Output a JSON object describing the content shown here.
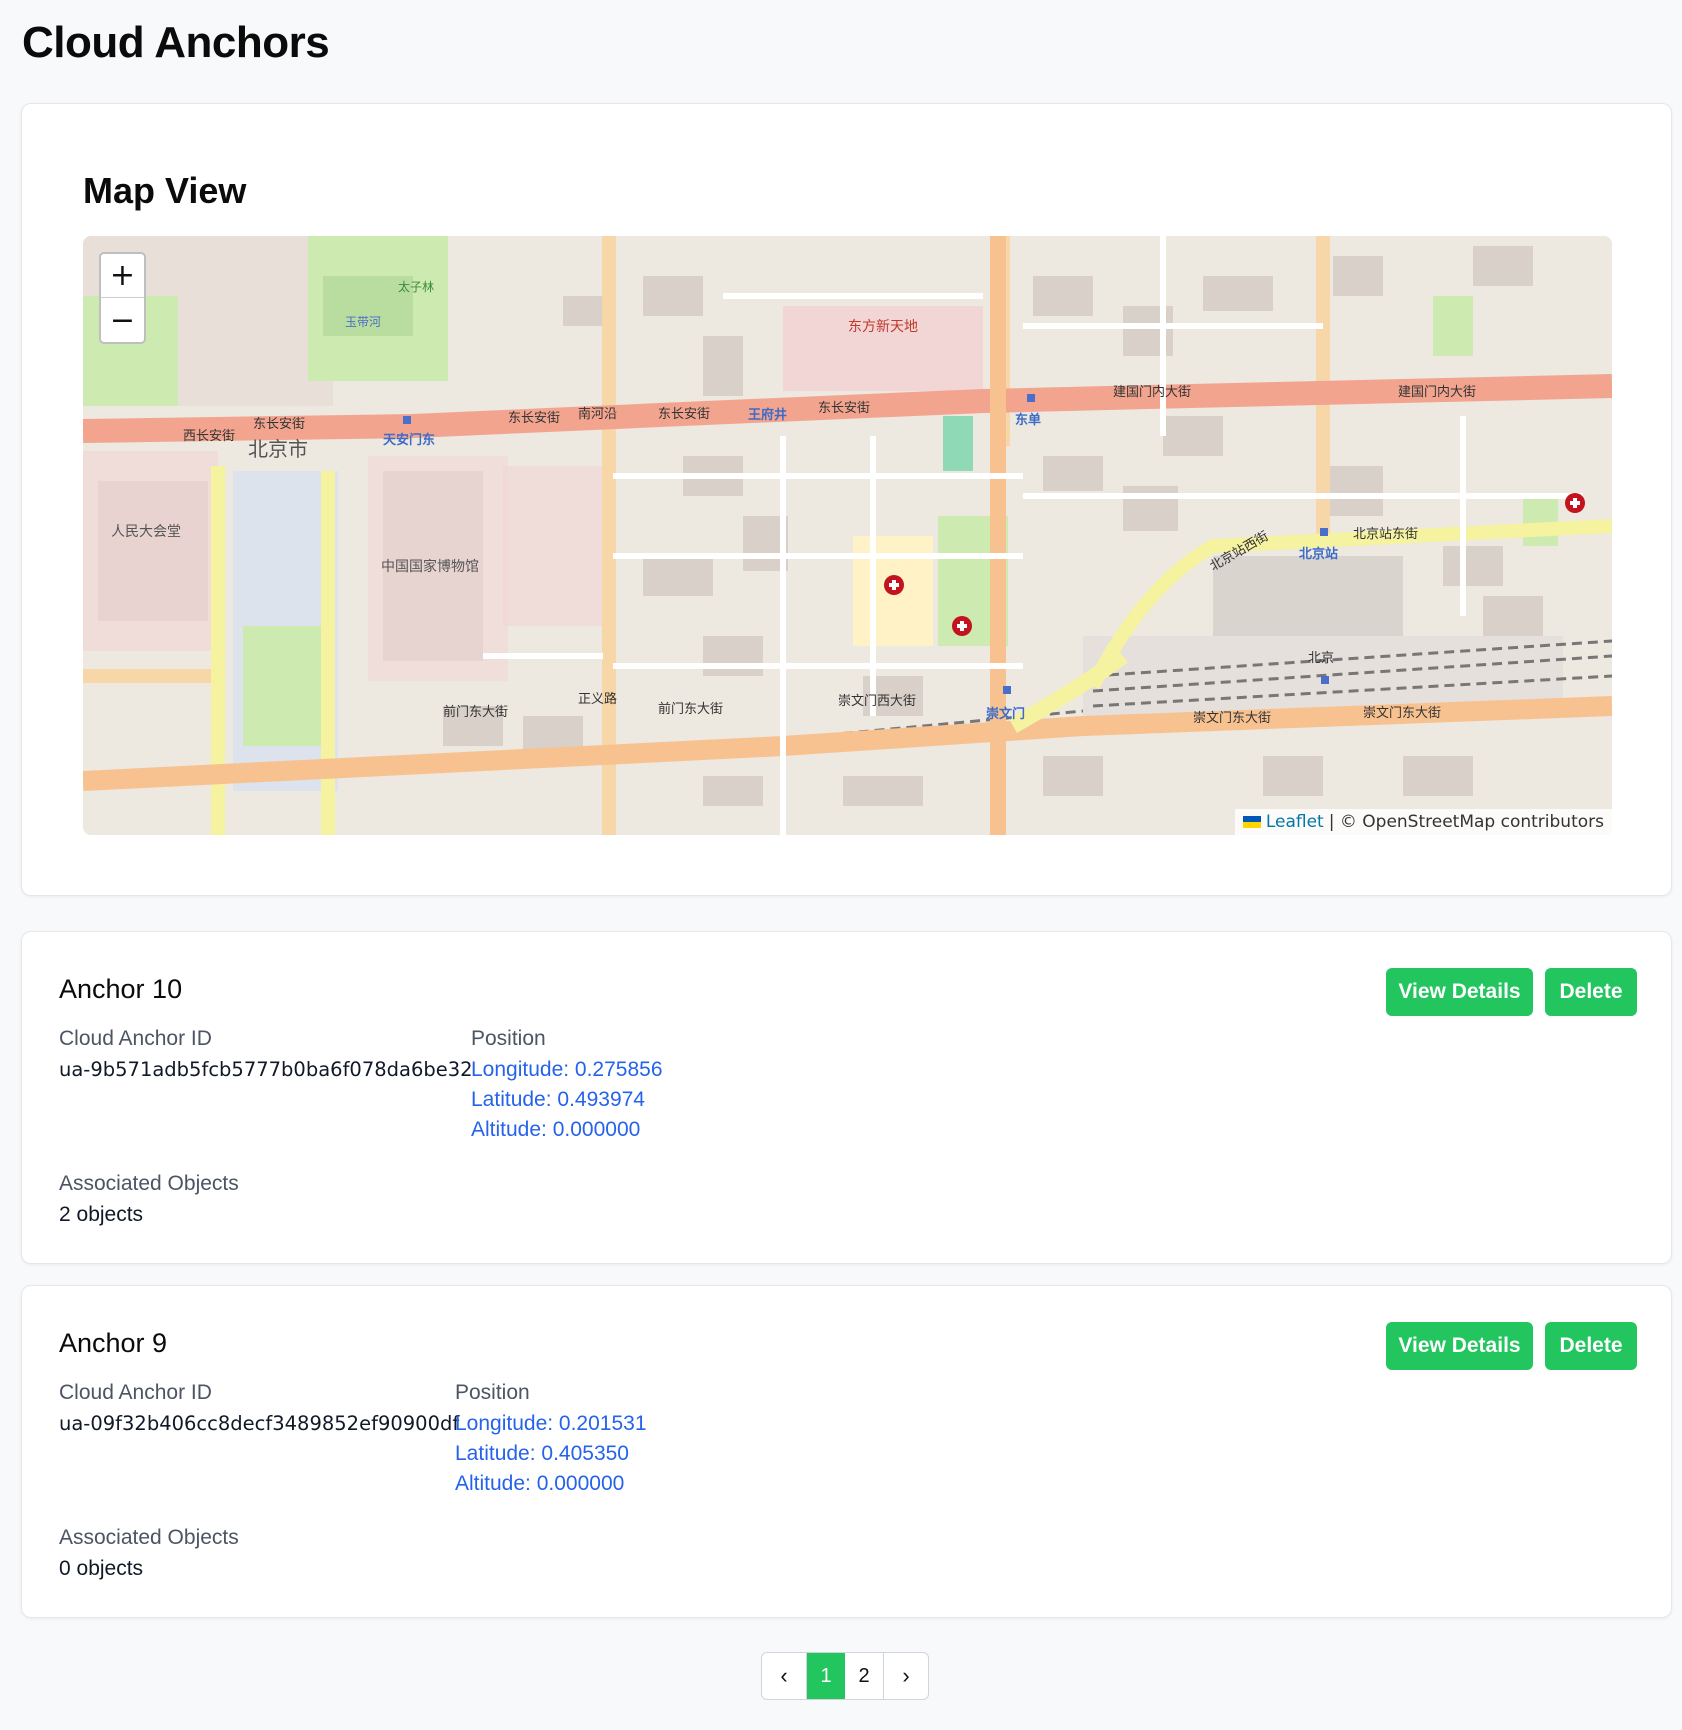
{
  "page": {
    "title": "Cloud Anchors"
  },
  "map": {
    "title": "Map View",
    "zoom_in": "+",
    "zoom_out": "−",
    "attribution_link": "Leaflet",
    "attribution_text": "| © OpenStreetMap contributors",
    "labels": {
      "tiananmen_east": "天安门东",
      "wangfujing": "王府井",
      "dongdan": "东单",
      "beijing_station": "北京站",
      "beijing_city": "北京市",
      "oriental_plaza": "东方新天地",
      "national_museum": "中国国家博物馆",
      "great_hall": "人民大会堂",
      "east_changan": "东长安街",
      "west_changan": "西长安街",
      "jianguomennei": "建国门内大街",
      "qianmen_east": "前门东大街",
      "chongwenmen_west": "崇文门西大街",
      "chongwenmen_east": "崇文门东大街",
      "chongwenmen": "崇文门",
      "beijingzhan_west": "北京站西街",
      "beijingzhan_east": "北京站东街",
      "nanheyan": "南河沿",
      "taizilin": "太子林",
      "yudaihe": "玉带河",
      "zhengyi_road": "正义路",
      "beijing": "北京"
    }
  },
  "anchors": [
    {
      "name": "Anchor 10",
      "id_label": "Cloud Anchor ID",
      "id_value": "ua-9b571adb5fcb5777b0ba6f078da6be32",
      "position_label": "Position",
      "longitude": "Longitude: 0.275856",
      "latitude": "Latitude: 0.493974",
      "altitude": "Altitude: 0.000000",
      "objects_label": "Associated Objects",
      "objects_value": "2 objects",
      "view_label": "View Details",
      "delete_label": "Delete"
    },
    {
      "name": "Anchor 9",
      "id_label": "Cloud Anchor ID",
      "id_value": "ua-09f32b406cc8decf3489852ef90900df",
      "position_label": "Position",
      "longitude": "Longitude: 0.201531",
      "latitude": "Latitude: 0.405350",
      "altitude": "Altitude: 0.000000",
      "objects_label": "Associated Objects",
      "objects_value": "0 objects",
      "view_label": "View Details",
      "delete_label": "Delete"
    }
  ],
  "pagination": {
    "prev_icon": "‹",
    "next_icon": "›",
    "pages": [
      "1",
      "2"
    ],
    "active_page": "1"
  },
  "colors": {
    "accent": "#22c55e",
    "link": "#2563eb",
    "major_road": "#f2a48f",
    "secondary_road": "#f7d7a8",
    "park": "#cdebb0"
  }
}
